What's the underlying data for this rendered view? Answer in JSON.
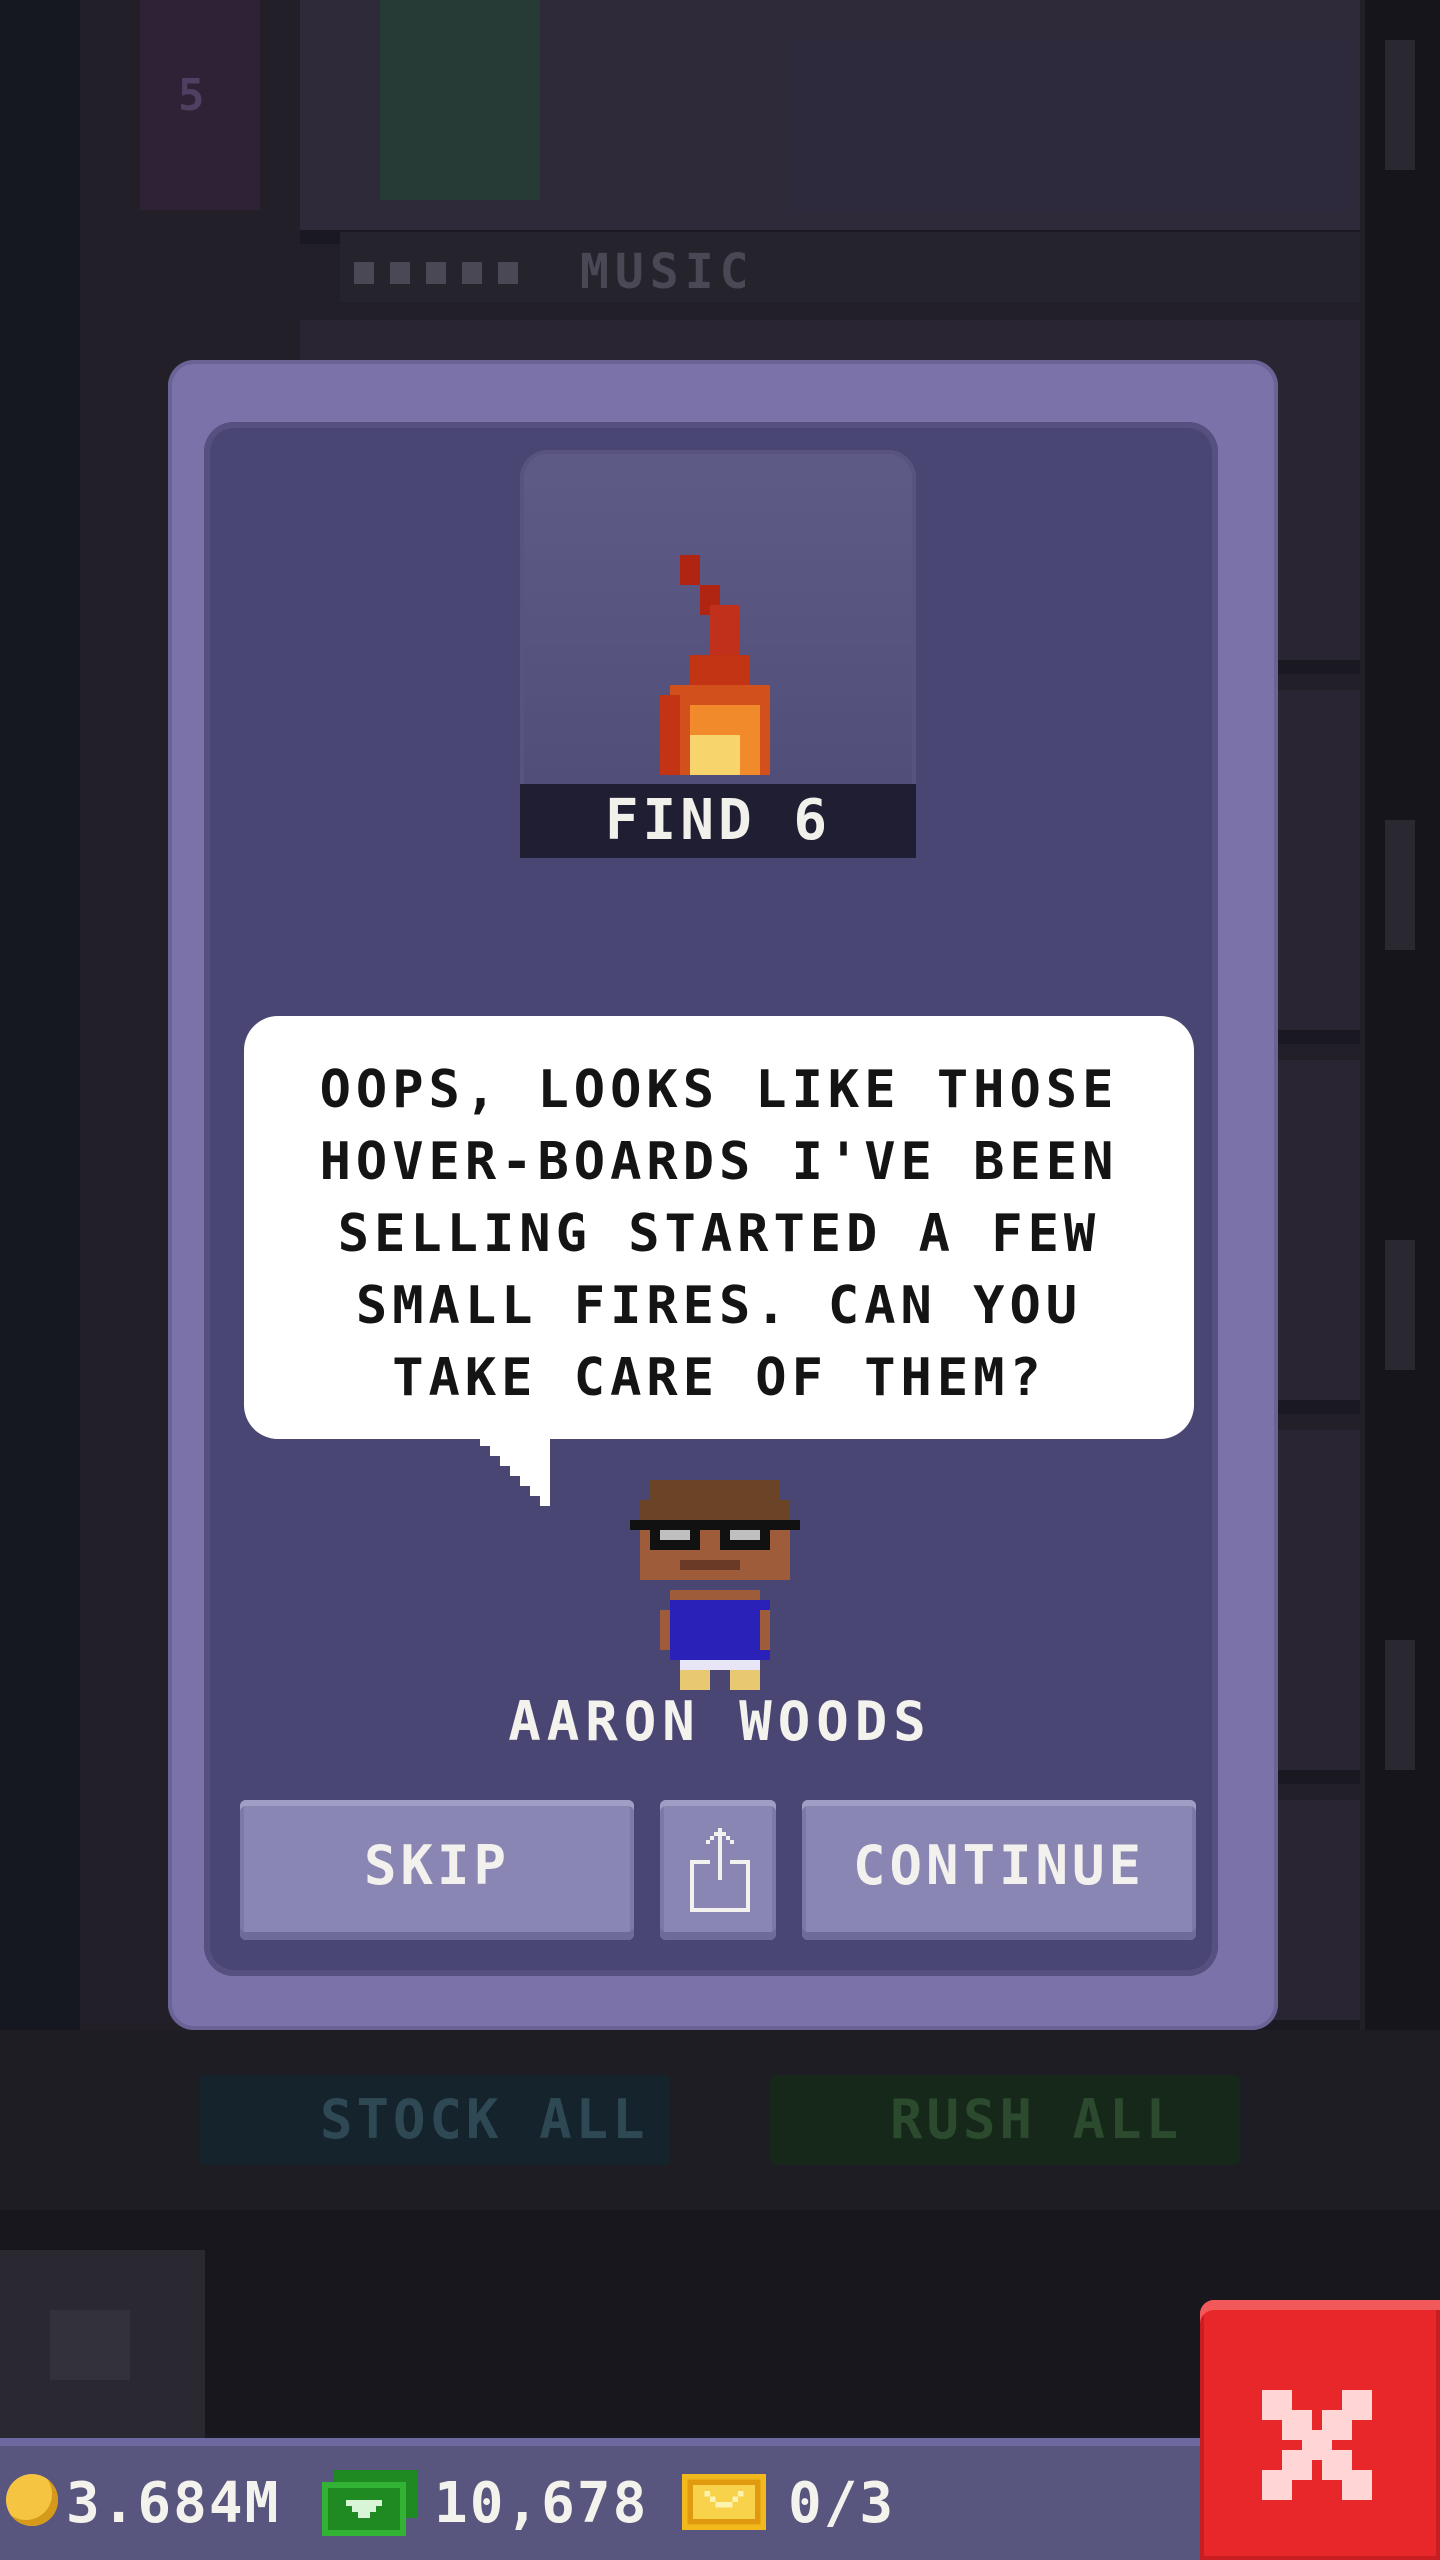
{
  "background": {
    "floor_number": "5",
    "floor_label": "MUSIC",
    "stock_all_label": "STOCK ALL",
    "rush_all_label": "RUSH ALL"
  },
  "mission": {
    "icon": "flame-icon",
    "task_label": "FIND 6",
    "message": "OOPS, LOOKS LIKE THOSE HOVER-BOARDS I'VE BEEN SELLING STARTED A FEW SMALL FIRES. CAN YOU TAKE CARE OF THEM?",
    "character_name": "AARON WOODS"
  },
  "buttons": {
    "skip": "SKIP",
    "share_icon": "share-icon",
    "continue": "CONTINUE"
  },
  "status": {
    "coins": "3.684M",
    "bux": "10,678",
    "tickets": "0/3"
  },
  "colors": {
    "dialog_frame": "#7a72a8",
    "dialog_inner": "#4a4674",
    "button": "#8a86b4",
    "close_button": "#e8272a",
    "status_bar": "#58557e"
  }
}
